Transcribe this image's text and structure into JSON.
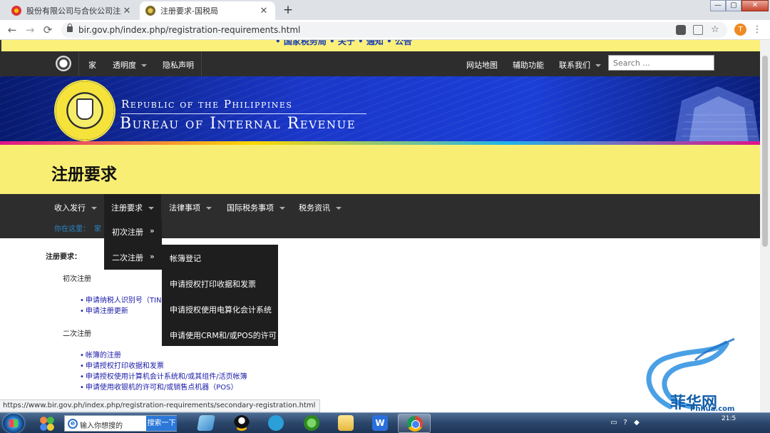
{
  "browser": {
    "tabs": [
      {
        "title": "股份有限公司与合伙公司注册攻",
        "close": "✕"
      },
      {
        "title": "注册要求-国税局",
        "close": "✕"
      }
    ],
    "new_tab": "+",
    "window": {
      "minimize": "—",
      "maximize": "▢",
      "close": "✕"
    },
    "back": "←",
    "forward": "→",
    "reload": "⟳",
    "url": "bir.gov.ph/index.php/registration-requirements.html",
    "profile_initial": "T",
    "menu": "⋮",
    "star": "☆"
  },
  "site": {
    "marquee": "• 国家税务局 • 关于 • 通知 • 公告",
    "top_nav": {
      "home": "家",
      "transparency": "透明度",
      "privacy": "隐私声明",
      "sitemap": "网站地图",
      "accessibility": "辅助功能",
      "contact": "联系我们"
    },
    "search": {
      "placeholder": "Search ..."
    },
    "banner": {
      "line1": "Republic of the Philippines",
      "line2": "Bureau of Internal Revenue"
    },
    "page_title": "注册要求",
    "main_nav": {
      "revenue": "收入发行",
      "registration": "注册要求",
      "legal": "法律事项",
      "international": "国际税务事项",
      "tax_info": "税务资讯"
    },
    "breadcrumb": {
      "label": "你在这里：",
      "home": "家"
    },
    "dropdown_1": [
      {
        "label": "初次注册",
        "arrow": "»"
      },
      {
        "label": "二次注册",
        "arrow": "»"
      }
    ],
    "dropdown_2": [
      "帐簿登记",
      "申请授权打印收据和发票",
      "申请授权使用电算化会计系统",
      "申请使用CRM和/或POS的许可"
    ],
    "content": {
      "heading": "注册要求：",
      "initial": {
        "heading": "初次注册",
        "links": [
          "申请纳税人识别号（TIN）",
          "申请注册更新"
        ]
      },
      "secondary": {
        "heading": "二次注册",
        "links": [
          "帐簿的注册",
          "申请授权打印收据和发票",
          "申请授权使用计算机会计系统和/或其组件/活页帐簿",
          "申请使用收银机的许可和/或销售点机器（POS）"
        ]
      }
    }
  },
  "status_url": "https://www.bir.gov.ph/index.php/registration-requirements/secondary-registration.html",
  "watermark": {
    "text": "菲华网",
    "url": "Phhua.com"
  },
  "taskbar": {
    "search_placeholder": "输入你想搜的",
    "search_button": "搜索一下",
    "wps_glyph": "W",
    "clock": "21:5"
  }
}
